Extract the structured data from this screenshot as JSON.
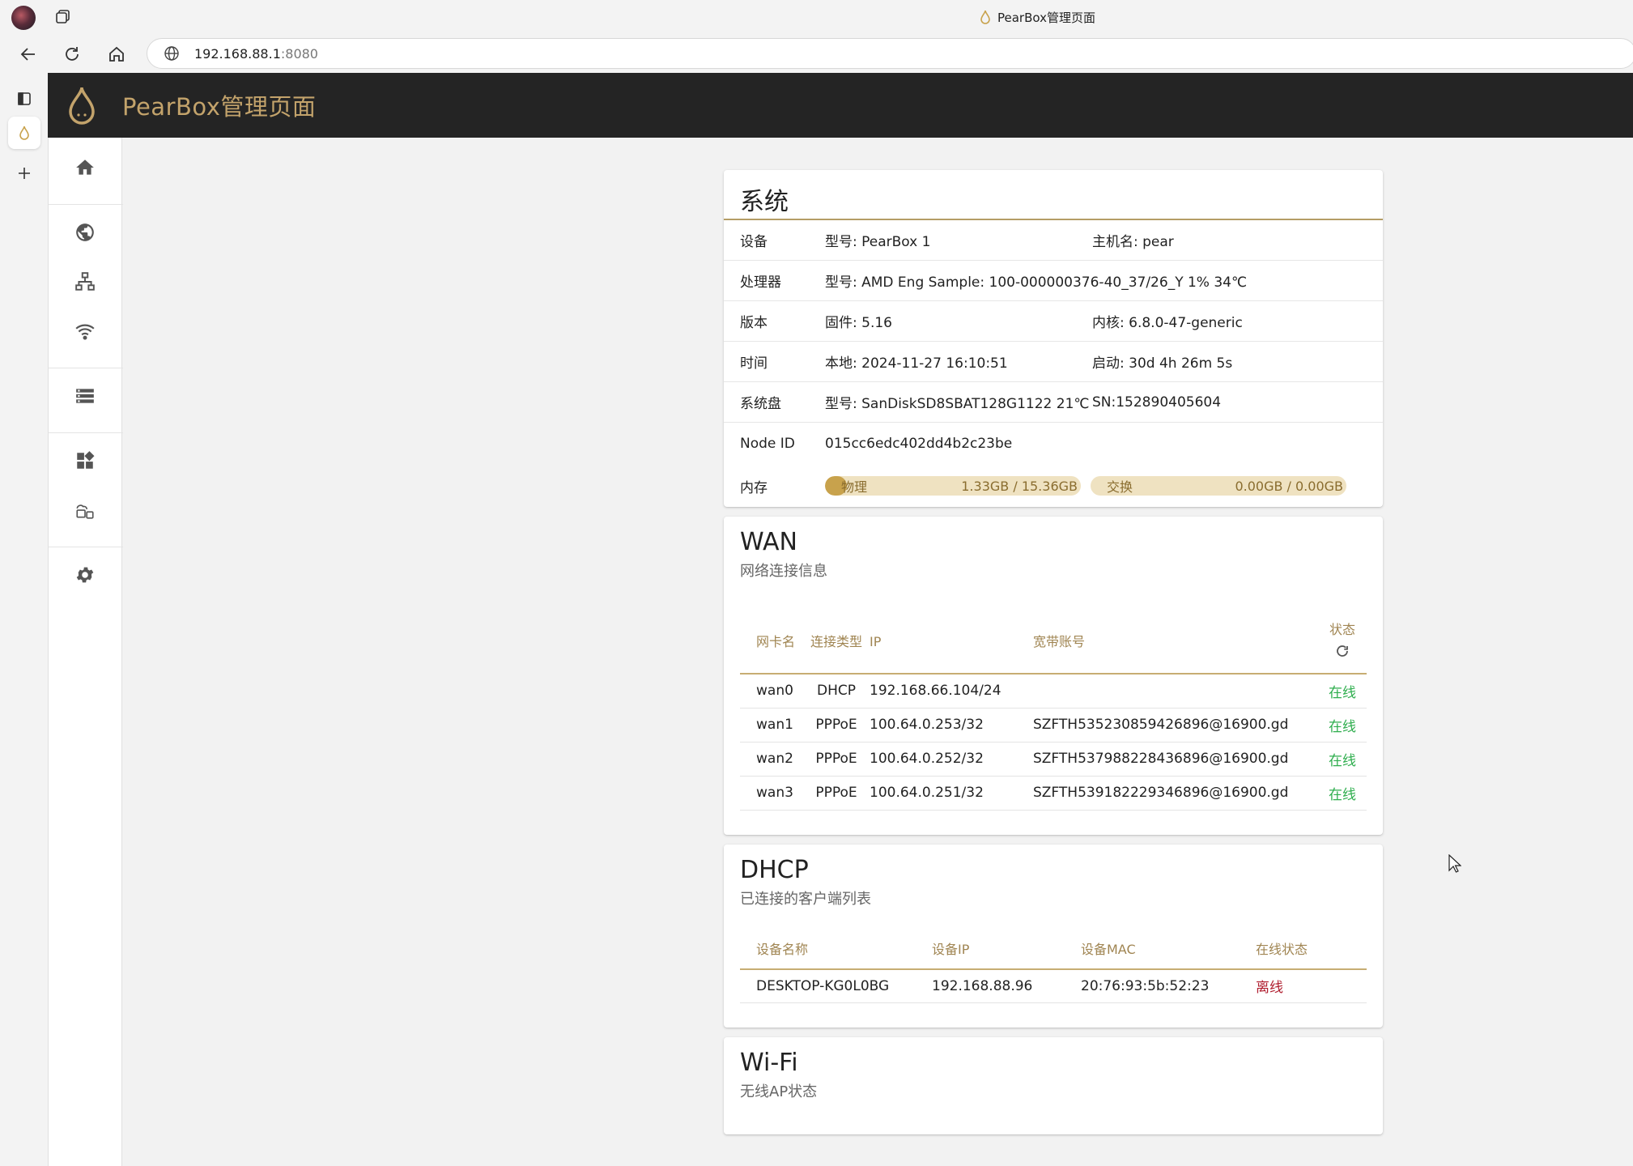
{
  "browser": {
    "tab_title": "PearBox管理页面",
    "url_host": "192.168.88.1",
    "url_port": ":8080"
  },
  "app": {
    "title": "PearBox管理页面",
    "accent_color": "#c3a36b"
  },
  "sidebar": {
    "icons": [
      "home-icon",
      "globe-icon",
      "network-icon",
      "wifi-icon",
      "list-icon",
      "apps-icon",
      "cloud-devices-icon",
      "gear-icon"
    ]
  },
  "system": {
    "title": "系统",
    "rows": [
      {
        "label": "设备",
        "col1": "型号: PearBox 1",
        "col2": "主机名: pear"
      },
      {
        "label": "处理器",
        "col1": "型号: AMD Eng Sample: 100-000000376-40_37/26_Y  1%  34℃",
        "col2": ""
      },
      {
        "label": "版本",
        "col1": "固件: 5.16",
        "col2": "内核: 6.8.0-47-generic"
      },
      {
        "label": "时间",
        "col1": "本地: 2024-11-27 16:10:51",
        "col2": "启动: 30d 4h 26m 5s"
      },
      {
        "label": "系统盘",
        "col1": "型号: SanDiskSD8SBAT128G1122  21℃",
        "col2": "SN:152890405604"
      },
      {
        "label": "Node ID",
        "col1": "015cc6edc402dd4b2c23be",
        "col2": ""
      }
    ],
    "memory": {
      "label": "内存",
      "physical_label": "物理",
      "physical_value": "1.33GB / 15.36GB",
      "physical_fraction": 0.087,
      "swap_label": "交换",
      "swap_value": "0.00GB / 0.00GB",
      "swap_fraction": 0.0
    }
  },
  "wan": {
    "title": "WAN",
    "subtitle": "网络连接信息",
    "headers": {
      "nic": "网卡名",
      "type": "连接类型",
      "ip": "IP",
      "account": "宽带账号",
      "status": "状态"
    },
    "rows": [
      {
        "nic": "wan0",
        "type": "DHCP",
        "ip": "192.168.66.104/24",
        "account": "",
        "status": "在线"
      },
      {
        "nic": "wan1",
        "type": "PPPoE",
        "ip": "100.64.0.253/32",
        "account": "SZFTH535230859426896@16900.gd",
        "status": "在线"
      },
      {
        "nic": "wan2",
        "type": "PPPoE",
        "ip": "100.64.0.252/32",
        "account": "SZFTH537988228436896@16900.gd",
        "status": "在线"
      },
      {
        "nic": "wan3",
        "type": "PPPoE",
        "ip": "100.64.0.251/32",
        "account": "SZFTH539182229346896@16900.gd",
        "status": "在线"
      }
    ]
  },
  "dhcp": {
    "title": "DHCP",
    "subtitle": "已连接的客户端列表",
    "headers": {
      "name": "设备名称",
      "ip": "设备IP",
      "mac": "设备MAC",
      "state": "在线状态"
    },
    "rows": [
      {
        "name": "DESKTOP-KG0L0BG",
        "ip": "192.168.88.96",
        "mac": "20:76:93:5b:52:23",
        "state": "离线"
      }
    ]
  },
  "wifi": {
    "title": "Wi-Fi",
    "subtitle": "无线AP状态"
  }
}
